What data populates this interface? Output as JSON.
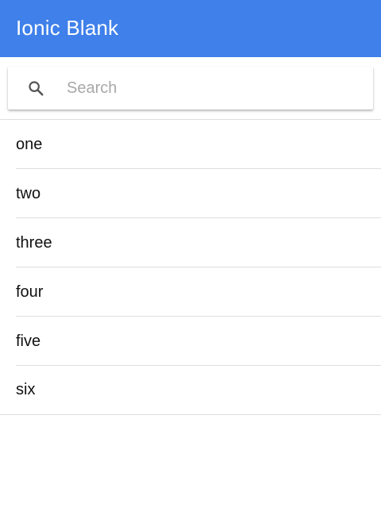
{
  "header": {
    "title": "Ionic Blank"
  },
  "search": {
    "placeholder": "Search",
    "value": ""
  },
  "list": {
    "items": [
      {
        "label": "one"
      },
      {
        "label": "two"
      },
      {
        "label": "three"
      },
      {
        "label": "four"
      },
      {
        "label": "five"
      },
      {
        "label": "six"
      }
    ]
  },
  "colors": {
    "toolbar": "#3f80ea",
    "divider": "#dedede"
  }
}
